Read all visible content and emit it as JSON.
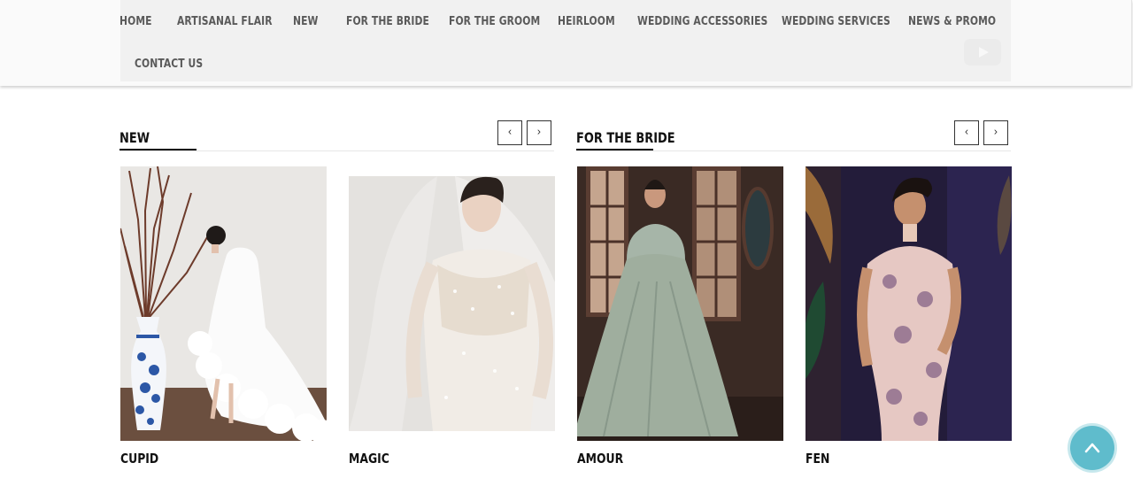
{
  "nav": {
    "items": [
      "HOME",
      "ARTISANAL FLAIR",
      "NEW",
      "FOR THE BRIDE",
      "FOR THE GROOM",
      "HEIRLOOM",
      "WEDDING ACCESSORIES",
      "WEDDING SERVICES",
      "NEWS & PROMO",
      "CONTACT US"
    ],
    "social_icon": "youtube-icon"
  },
  "sections": [
    {
      "title": "NEW",
      "prev_label": "‹",
      "next_label": "›"
    },
    {
      "title": "FOR THE BRIDE",
      "prev_label": "‹",
      "next_label": "›"
    }
  ],
  "products": [
    {
      "name": "CUPID"
    },
    {
      "name": "MAGIC"
    },
    {
      "name": "AMOUR"
    },
    {
      "name": "FEN"
    }
  ],
  "back_to_top": {
    "icon": "chevron-up-icon",
    "color": "#5fbccc"
  }
}
